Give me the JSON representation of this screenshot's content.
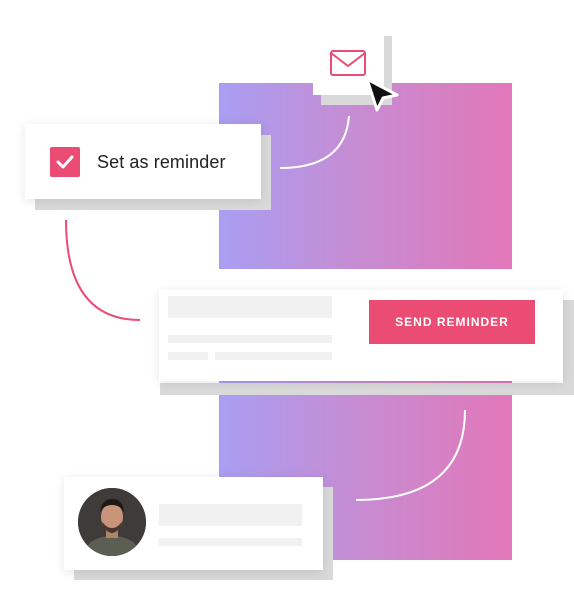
{
  "reminder_card": {
    "checkbox_checked": true,
    "label": "Set as reminder"
  },
  "send_card": {
    "button_label": "SEND REMINDER"
  },
  "icons": {
    "mail": "envelope-icon",
    "cursor": "cursor-arrow-icon",
    "check": "checkmark-icon"
  },
  "colors": {
    "accent": "#ea4c73",
    "gradient_start": "#a99ef3",
    "gradient_end": "#e277b9",
    "placeholder": "#f1f1f2",
    "shadow": "#d9d9d9"
  }
}
